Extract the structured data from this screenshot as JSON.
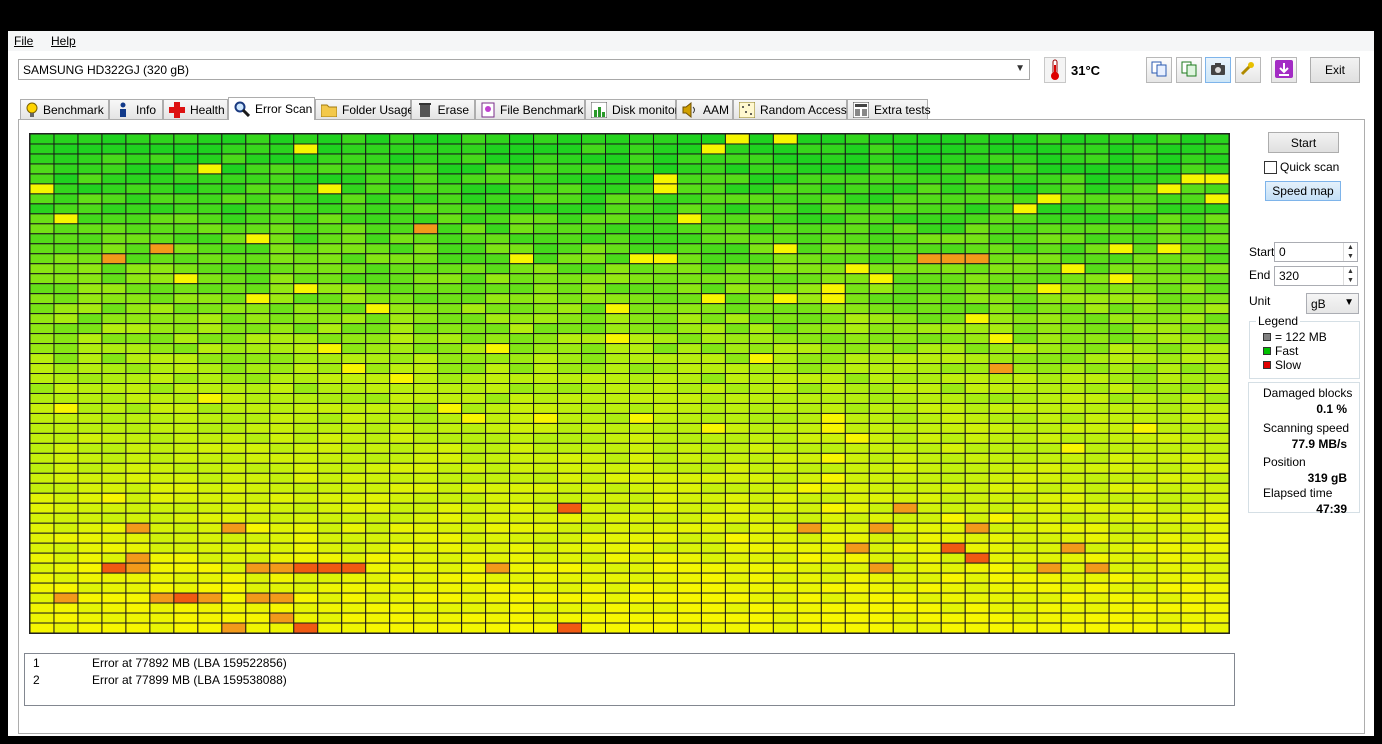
{
  "menu": {
    "file": "File",
    "help": "Help"
  },
  "drive": {
    "selected": "SAMSUNG HD322GJ (320 gB)"
  },
  "temperature": "31°C",
  "toolbar": {
    "exit_label": "Exit"
  },
  "tabs": [
    {
      "label": "Benchmark",
      "icon": "lightbulb-icon"
    },
    {
      "label": "Info",
      "icon": "info-icon"
    },
    {
      "label": "Health",
      "icon": "health-cross-icon"
    },
    {
      "label": "Error Scan",
      "icon": "magnifier-icon",
      "selected": true
    },
    {
      "label": "Folder Usage",
      "icon": "folder-icon"
    },
    {
      "label": "Erase",
      "icon": "trash-icon"
    },
    {
      "label": "File Benchmark",
      "icon": "file-benchmark-icon"
    },
    {
      "label": "Disk monitor",
      "icon": "disk-monitor-icon"
    },
    {
      "label": "AAM",
      "icon": "speaker-icon"
    },
    {
      "label": "Random Access",
      "icon": "random-access-icon"
    },
    {
      "label": "Extra tests",
      "icon": "extra-tests-icon"
    }
  ],
  "controls": {
    "start_label": "Start",
    "quick_scan_label": "Quick scan",
    "speed_map_label": "Speed map",
    "start_field_label": "Start",
    "start_value": "0",
    "end_field_label": "End",
    "end_value": "320",
    "unit_label": "Unit",
    "unit_value": "gB"
  },
  "legend": {
    "title": "Legend",
    "items": [
      {
        "label": "= 122 MB",
        "color": "#808080"
      },
      {
        "label": "Fast",
        "color": "#00c000"
      },
      {
        "label": "Slow",
        "color": "#e00000"
      }
    ]
  },
  "stats": {
    "damaged_label": "Damaged blocks",
    "damaged_value": "0.1 %",
    "speed_label": "Scanning speed",
    "speed_value": "77.9 MB/s",
    "position_label": "Position",
    "position_value": "319 gB",
    "elapsed_label": "Elapsed time",
    "elapsed_value": "47:39"
  },
  "log": [
    {
      "num": "1",
      "text": "Error at 77892 MB (LBA 159522856)"
    },
    {
      "num": "2",
      "text": "Error at 77899 MB (LBA 159538088)"
    }
  ],
  "scan_grid": {
    "columns": 50,
    "rows": 50,
    "colors": {
      "green_fast": "#1fd21f",
      "yellow_green": "#b4ee0f",
      "yellow": "#f6f600",
      "orange": "#f29a1a",
      "red_orange": "#f05a12"
    },
    "orange_blocks": [
      [
        9,
        16
      ],
      [
        11,
        5
      ],
      [
        12,
        3
      ],
      [
        12,
        37
      ],
      [
        12,
        38
      ],
      [
        12,
        39
      ],
      [
        23,
        40
      ],
      [
        37,
        22
      ],
      [
        37,
        36
      ],
      [
        39,
        4
      ],
      [
        39,
        8
      ],
      [
        39,
        32
      ],
      [
        39,
        35
      ],
      [
        39,
        39
      ],
      [
        41,
        34
      ],
      [
        41,
        38
      ],
      [
        41,
        43
      ],
      [
        42,
        4
      ],
      [
        43,
        3
      ],
      [
        43,
        4
      ],
      [
        43,
        9
      ],
      [
        43,
        10
      ],
      [
        43,
        11
      ],
      [
        43,
        12
      ],
      [
        43,
        13
      ],
      [
        43,
        19
      ],
      [
        43,
        35
      ],
      [
        43,
        42
      ],
      [
        43,
        44
      ],
      [
        46,
        1
      ],
      [
        46,
        5
      ],
      [
        46,
        6
      ],
      [
        46,
        7
      ],
      [
        46,
        9
      ],
      [
        46,
        10
      ],
      [
        49,
        8
      ],
      [
        49,
        11
      ],
      [
        49,
        22
      ],
      [
        48,
        10
      ]
    ],
    "red_blocks": [
      [
        37,
        22
      ],
      [
        43,
        3
      ],
      [
        43,
        11
      ],
      [
        43,
        12
      ],
      [
        43,
        13
      ],
      [
        46,
        6
      ],
      [
        49,
        11
      ],
      [
        49,
        22
      ],
      [
        42,
        39
      ],
      [
        41,
        38
      ]
    ]
  }
}
